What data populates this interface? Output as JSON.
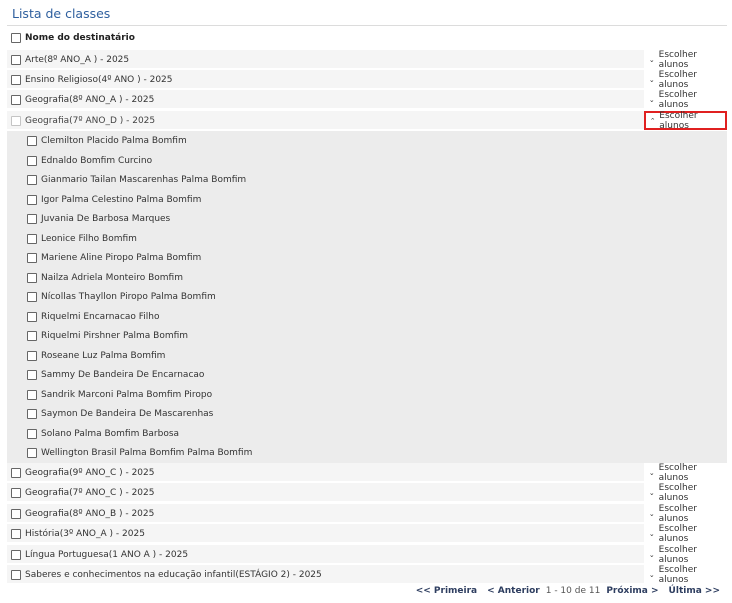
{
  "title": "Lista de classes",
  "header": {
    "label": "Nome do destinatário"
  },
  "button_label": "Escolher alunos",
  "classes_top": [
    "Arte(8º ANO_A ) - 2025",
    "Ensino Religioso(4º ANO ) - 2025",
    "Geografia(8º ANO_A ) - 2025"
  ],
  "expanded_class": "Geografia(7º ANO_D ) - 2025",
  "students": [
    "Clemilton Placido Palma Bomfim",
    "Ednaldo Bomfim Curcino",
    "Gianmario Tailan Mascarenhas Palma Bomfim",
    "Igor Palma Celestino Palma Bomfim",
    "Juvania De Barbosa Marques",
    "Leonice Filho Bomfim",
    "Mariene Aline Piropo Palma Bomfim",
    "Nailza Adriela Monteiro Bomfim",
    "Nícollas Thayllon Piropo Palma Bomfim",
    "Riquelmi Encarnacao Filho",
    "Riquelmi Pirshner Palma Bomfim",
    "Roseane Luz Palma Bomfim",
    "Sammy De Bandeira De Encarnacao",
    "Sandrik Marconi Palma Bomfim Piropo",
    "Saymon De Bandeira De Mascarenhas",
    "Solano Palma Bomfim Barbosa",
    "Wellington Brasil Palma Bomfim Palma Bomfim"
  ],
  "classes_bottom": [
    "Geografia(9º ANO_C ) - 2025",
    "Geografia(7º ANO_C ) - 2025",
    "Geografia(8º ANO_B ) - 2025",
    "História(3º ANO_A ) - 2025",
    "Língua Portuguesa(1 ANO A ) - 2025",
    "Saberes e conhecimentos na educação infantil(ESTÁGIO 2) - 2025"
  ],
  "pager": {
    "first": "<< Primeira",
    "prev": "< Anterior",
    "range": "1 - 10 de 11",
    "next": "Próxima >",
    "last": "Última >>"
  },
  "colors": {
    "title": "#2e5f9e",
    "highlight_border": "#e02020"
  }
}
